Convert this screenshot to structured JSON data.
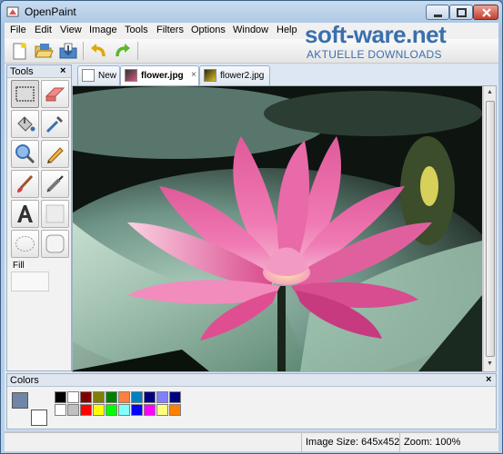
{
  "window": {
    "title": "OpenPaint"
  },
  "menu": [
    "File",
    "Edit",
    "View",
    "Image",
    "Tools",
    "Filters",
    "Options",
    "Window",
    "Help"
  ],
  "watermark": {
    "main": "soft-ware.net",
    "sub": "AKTUELLE DOWNLOADS"
  },
  "tools_panel": {
    "title": "Tools",
    "close": "×",
    "fill_label": "Fill"
  },
  "tabs": [
    {
      "label": "New"
    },
    {
      "label": "flower.jpg",
      "close": "×"
    },
    {
      "label": "flower2.jpg"
    }
  ],
  "colors_panel": {
    "title": "Colors",
    "close": "×",
    "primary": "#6f86a6",
    "secondary": "#ffffff",
    "palette_row1": [
      "#000000",
      "#ffffff",
      "#800000",
      "#808000",
      "#008000",
      "#ff8040",
      "#0080c0",
      "#000080",
      "#8080ff",
      "#000080"
    ],
    "palette_row2": [
      "#ffffff",
      "#c0c0c0",
      "#ff0000",
      "#ffff00",
      "#00ff00",
      "#80ffff",
      "#0000ff",
      "#ff00ff",
      "#ffff80",
      "#ff8000"
    ]
  },
  "status": {
    "image_size": "Image Size: 645x452",
    "zoom": "Zoom: 100%"
  }
}
